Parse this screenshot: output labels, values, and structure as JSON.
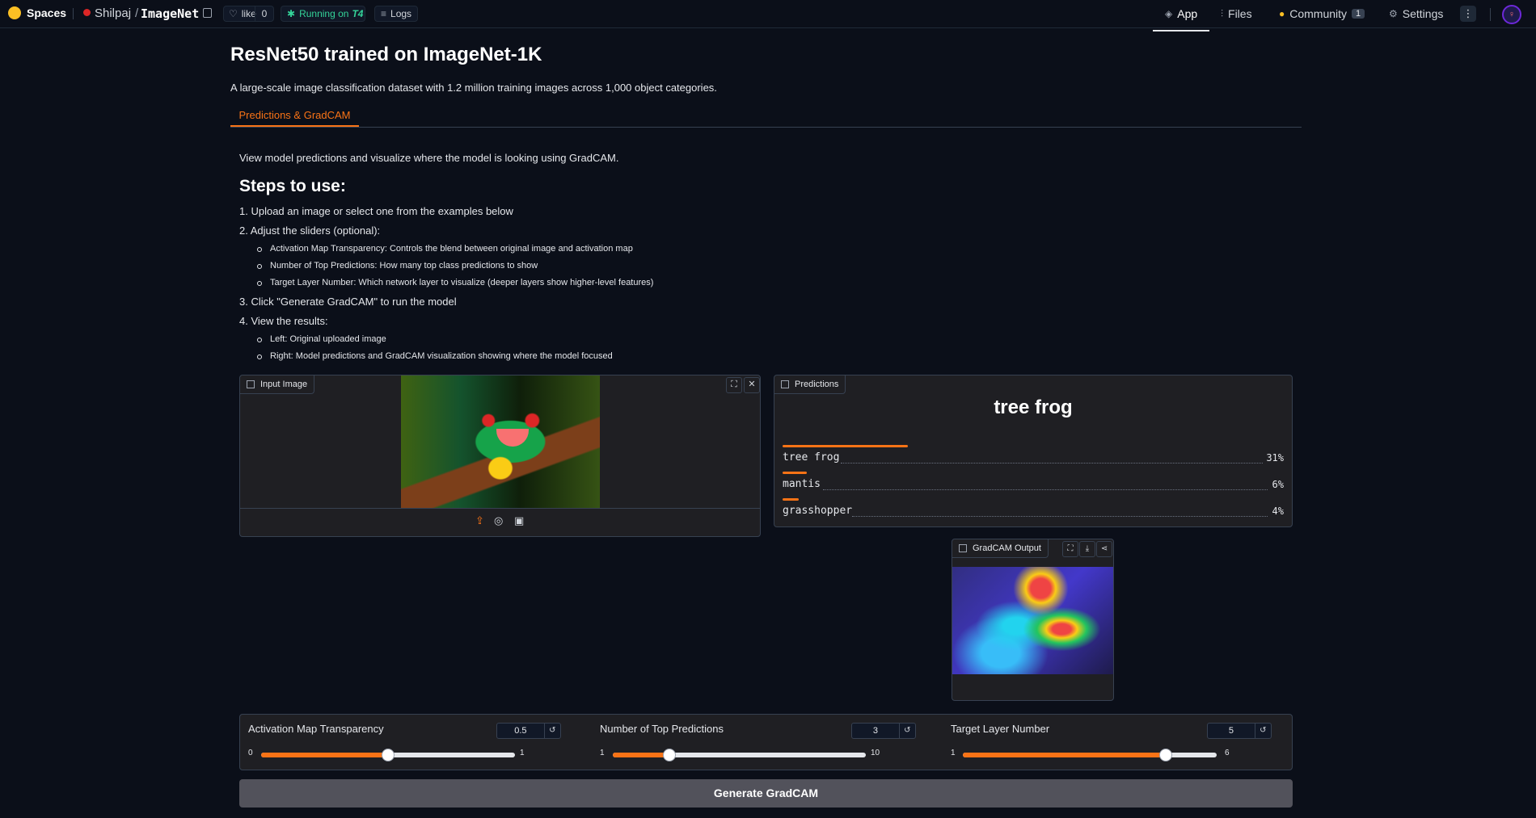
{
  "topbar": {
    "spaces_label": "Spaces",
    "owner": "Shilpaj",
    "slash": "/",
    "repo": "ImageNet",
    "like_label": "like",
    "like_count": "0",
    "running_label": "Running on",
    "hardware": "T4",
    "logs_label": "Logs",
    "nav": {
      "app": "App",
      "files": "Files",
      "community": "Community",
      "community_count": "1",
      "settings": "Settings"
    }
  },
  "header": {
    "title": "ResNet50 trained on ImageNet-1K",
    "subtitle": "A large-scale image classification dataset with 1.2 million training images across 1,000 object categories.",
    "tab": "Predictions & GradCAM"
  },
  "instructions": {
    "intro": "View model predictions and visualize where the model is looking using GradCAM.",
    "heading": "Steps to use:",
    "step1": "1. Upload an image or select one from the examples below",
    "step2": "2. Adjust the sliders (optional):",
    "step2_items": [
      "Activation Map Transparency: Controls the blend between original image and activation map",
      "Number of Top Predictions: How many top class predictions to show",
      "Target Layer Number: Which network layer to visualize (deeper layers show higher-level features)"
    ],
    "step3": "3. Click \"Generate GradCAM\" to run the model",
    "step4": "4. View the results:",
    "step4_items": [
      "Left: Original uploaded image",
      "Right: Model predictions and GradCAM visualization showing where the model focused"
    ]
  },
  "input_panel": {
    "label": "Input Image"
  },
  "predictions_panel": {
    "label": "Predictions",
    "top_label": "tree frog",
    "items": [
      {
        "label": "tree frog",
        "pct": "31%",
        "value": 0.31
      },
      {
        "label": "mantis",
        "pct": "6%",
        "value": 0.06
      },
      {
        "label": "grasshopper",
        "pct": "4%",
        "value": 0.04
      }
    ]
  },
  "gradcam_panel": {
    "label": "GradCAM Output"
  },
  "sliders": [
    {
      "label": "Activation Map Transparency",
      "value": "0.5",
      "min": "0",
      "max": "1",
      "fraction": 0.5
    },
    {
      "label": "Number of Top Predictions",
      "value": "3",
      "min": "1",
      "max": "10",
      "fraction": 0.2222
    },
    {
      "label": "Target Layer Number",
      "value": "5",
      "min": "1",
      "max": "6",
      "fraction": 0.8
    }
  ],
  "generate_button": "Generate GradCAM",
  "colors": {
    "accent": "#f97316",
    "background": "#0b0f19",
    "panel": "#1f1f23"
  }
}
